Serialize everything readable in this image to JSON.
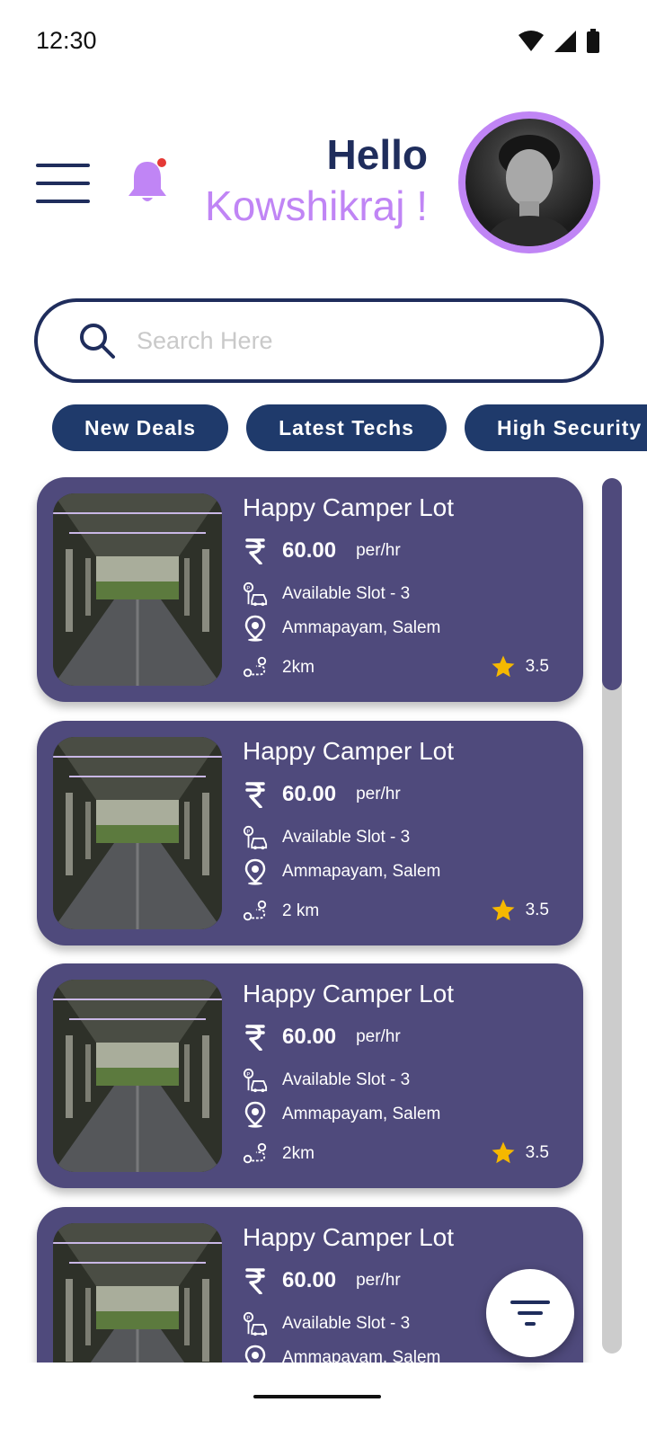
{
  "status": {
    "time": "12:30"
  },
  "header": {
    "hello": "Hello",
    "name": "Kowshikraj !"
  },
  "search": {
    "placeholder": "Search Here"
  },
  "chips": [
    "New Deals",
    "Latest Techs",
    "High Security"
  ],
  "cards": [
    {
      "title": "Happy Camper Lot",
      "price": "60.00",
      "unit": "per/hr",
      "slots": "Available Slot - 3",
      "location": "Ammapayam, Salem",
      "distance": "2km",
      "rating": "3.5"
    },
    {
      "title": "Happy Camper Lot",
      "price": "60.00",
      "unit": "per/hr",
      "slots": "Available Slot - 3",
      "location": "Ammapayam, Salem",
      "distance": "2 km",
      "rating": "3.5"
    },
    {
      "title": "Happy Camper Lot",
      "price": "60.00",
      "unit": "per/hr",
      "slots": "Available Slot - 3",
      "location": "Ammapayam, Salem",
      "distance": "2km",
      "rating": "3.5"
    },
    {
      "title": "Happy Camper Lot",
      "price": "60.00",
      "unit": "per/hr",
      "slots": "Available Slot - 3",
      "location": "Ammapayam, Salem",
      "distance": "",
      "rating": ""
    }
  ],
  "icons": {
    "menu": "hamburger-menu-icon",
    "bell": "bell-icon",
    "search": "search-icon",
    "currency": "rupee-icon",
    "parking": "parking-car-icon",
    "location": "location-pin-icon",
    "route": "route-icon",
    "rating": "star-icon",
    "filter": "filter-icon"
  },
  "colors": {
    "primary": "#1f2d5c",
    "accent": "#c085f5",
    "card": "#4f4a7c",
    "chip": "#1f3a6b",
    "star": "#f5b800",
    "notification_dot": "#e53935"
  }
}
